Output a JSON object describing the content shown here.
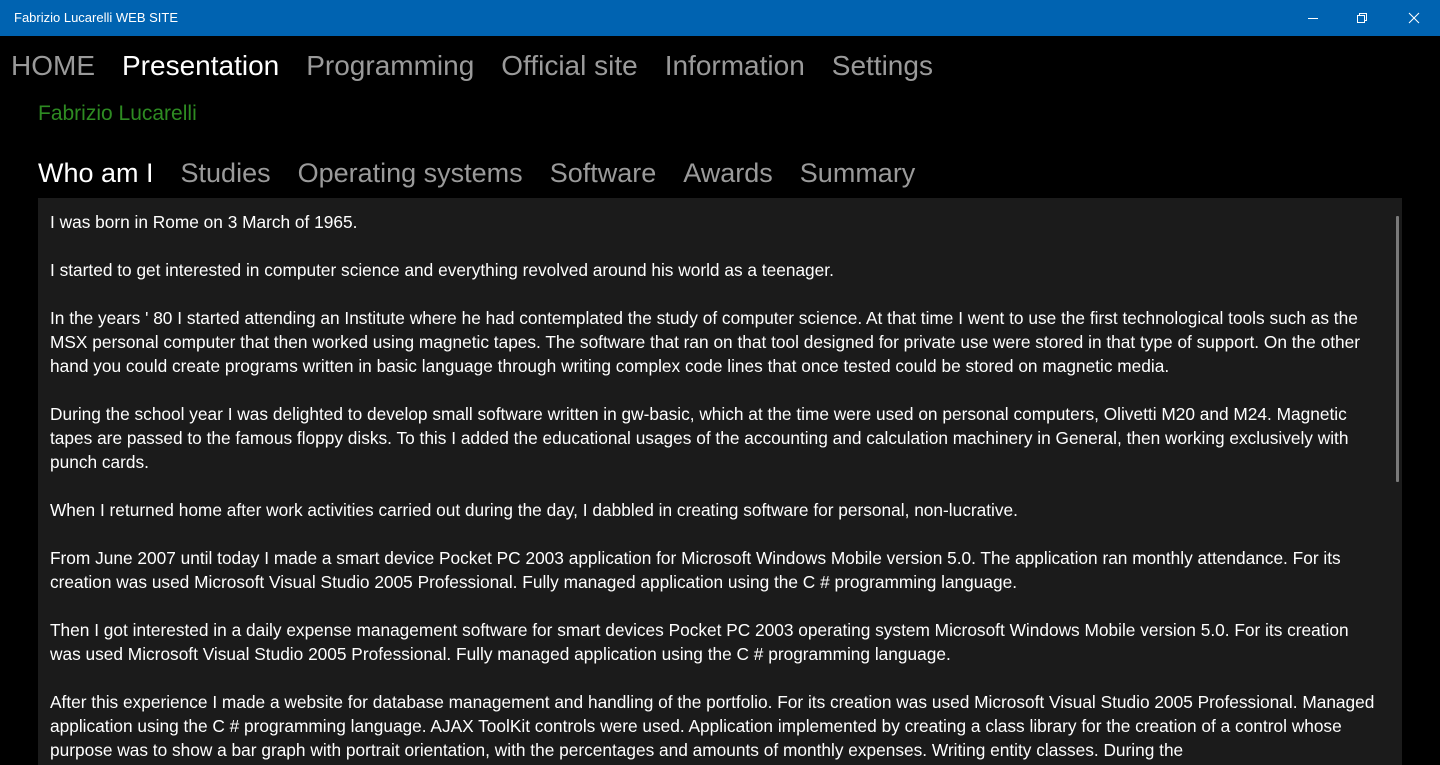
{
  "window": {
    "title": "Fabrizio Lucarelli WEB SITE",
    "controls": {
      "minimize_icon": "minimize-icon",
      "maximize_icon": "restore-icon",
      "close_icon": "close-icon"
    }
  },
  "nav": {
    "items": [
      {
        "label": "HOME",
        "active": false
      },
      {
        "label": "Presentation",
        "active": true
      },
      {
        "label": "Programming",
        "active": false
      },
      {
        "label": "Official site",
        "active": false
      },
      {
        "label": "Information",
        "active": false
      },
      {
        "label": "Settings",
        "active": false
      }
    ]
  },
  "page": {
    "heading": "Fabrizio Lucarelli",
    "heading_color": "#2e8b22"
  },
  "tabs": {
    "items": [
      {
        "label": "Who am I",
        "active": true
      },
      {
        "label": "Studies",
        "active": false
      },
      {
        "label": "Operating systems",
        "active": false
      },
      {
        "label": "Software",
        "active": false
      },
      {
        "label": "Awards",
        "active": false
      },
      {
        "label": "Summary",
        "active": false
      }
    ]
  },
  "content": {
    "paragraphs": [
      "I was born in Rome on 3 March of 1965.",
      "I started to get interested in computer science and everything revolved around his world as a teenager.",
      "In the years ' 80 I started attending an Institute where he had contemplated the study of computer science. At that time I went to use the first technological tools such as the MSX personal computer that then worked using magnetic tapes. The software that ran on that tool designed for private use were stored in that type of support. On the other hand you could create programs written in basic language through writing complex code lines that once tested could be stored on magnetic media.",
      "During the school year I was delighted to develop small software written in gw-basic, which at the time were used on personal computers, Olivetti M20 and M24. Magnetic tapes are passed to the famous floppy disks. To this I added the educational usages of the accounting and calculation machinery in General, then working exclusively with punch cards.",
      "When I returned home after work activities carried out during the day, I dabbled in creating software for personal, non-lucrative.",
      "From June 2007 until today I made a smart device Pocket PC 2003 application for Microsoft Windows Mobile version 5.0. The application ran monthly attendance. For its creation was used Microsoft Visual Studio 2005 Professional. Fully managed application using the C # programming language.",
      "Then I got interested in a daily expense management software for smart devices Pocket PC 2003 operating system Microsoft Windows Mobile version 5.0. For its creation was used Microsoft Visual Studio 2005 Professional. Fully managed application using the C # programming language.",
      "After this experience I made a website for database management and handling of the portfolio. For its creation was used Microsoft Visual Studio 2005 Professional. Managed application using the C # programming language. AJAX ToolKit controls were used. Application implemented by creating a class library for the creation of a control whose purpose was to show a bar graph with portrait orientation, with the percentages and amounts of monthly expenses. Writing entity classes. During the"
    ]
  },
  "colors": {
    "titlebar_bg": "#0063b1",
    "background": "#000000",
    "panel_bg": "#1b1b1b",
    "inactive_text": "#9a9a9a",
    "active_text": "#ffffff"
  }
}
